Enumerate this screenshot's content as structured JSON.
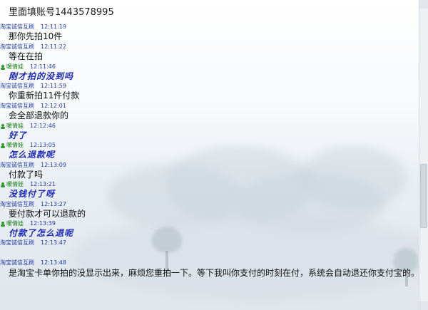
{
  "top_line": "里面填账号1443578995",
  "messages": [
    {
      "sender": "淘宝诚信互刷",
      "time": "12:11:19",
      "text": "那你先拍10件",
      "style": "normal"
    },
    {
      "sender": "淘宝诚信互刷",
      "time": "12:11:22",
      "text": "等在在拍",
      "style": "normal"
    },
    {
      "sender": "暖倩娃",
      "time": "12:11:46",
      "text": "刚才拍的没到吗",
      "style": "blue"
    },
    {
      "sender": "淘宝诚信互刷",
      "time": "12:11:59",
      "text": "你重新拍11件付款",
      "style": "normal"
    },
    {
      "sender": "淘宝诚信互刷",
      "time": "12:12:01",
      "text": "会全部退款你的",
      "style": "normal"
    },
    {
      "sender": "暖倩娃",
      "time": "12:12:46",
      "text": "好了",
      "style": "blue"
    },
    {
      "sender": "暖倩娃",
      "time": "12:13:05",
      "text": "怎么退款呢",
      "style": "blue"
    },
    {
      "sender": "淘宝诚信互刷",
      "time": "12:13:09",
      "text": "付款了吗",
      "style": "normal"
    },
    {
      "sender": "暖倩娃",
      "time": "12:13:21",
      "text": "没钱付了呀",
      "style": "blue"
    },
    {
      "sender": "淘宝诚信互刷",
      "time": "12:13:27",
      "text": "要付款才可以退款的",
      "style": "normal"
    },
    {
      "sender": "暖倩娃",
      "time": "12:13:39",
      "text": "付款了怎么退呢",
      "style": "blue"
    },
    {
      "sender": "淘宝诚信互刷",
      "time": "12:13:47",
      "text": "",
      "style": "normal"
    },
    {
      "sender": "淘宝诚信互刷",
      "time": "12:13:48",
      "text": "是淘宝卡单你拍的没显示出来，麻烦您重拍一下。等下我叫你支付的时刻在付，系统会自动退还你支付宝的。",
      "style": "wrap"
    }
  ],
  "colors": {
    "sender_blue": "#1f3ca8",
    "sender_green": "#1a7f1a",
    "message_blue": "#1f2bb8"
  },
  "icons": {
    "user_icon": "user-status-icon"
  }
}
